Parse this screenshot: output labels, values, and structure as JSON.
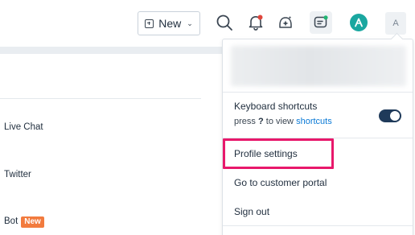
{
  "topbar": {
    "new_label": "New",
    "icons": [
      "search-icon",
      "notification-bell-icon",
      "ai-sparkle-icon",
      "chat-assistant-icon",
      "app-logo-icon"
    ],
    "notification_dot_color": "#e0463c",
    "avatar_initial": "A"
  },
  "background": {
    "items": [
      {
        "label": "Live Chat"
      },
      {
        "label": "Twitter"
      },
      {
        "label": "Bot",
        "badge": "New"
      }
    ],
    "badge_color": "#f27b3e"
  },
  "menu": {
    "shortcuts_title": "Keyboard shortcuts",
    "shortcuts_hint_prefix": "press",
    "shortcuts_hint_key": "?",
    "shortcuts_hint_middle": "to view",
    "shortcuts_hint_link": "shortcuts",
    "shortcuts_enabled": true,
    "items": [
      "Profile settings",
      "Go to customer portal",
      "Sign out"
    ],
    "highlight_color": "#e8186b",
    "link_color": "#0b7ad6"
  }
}
